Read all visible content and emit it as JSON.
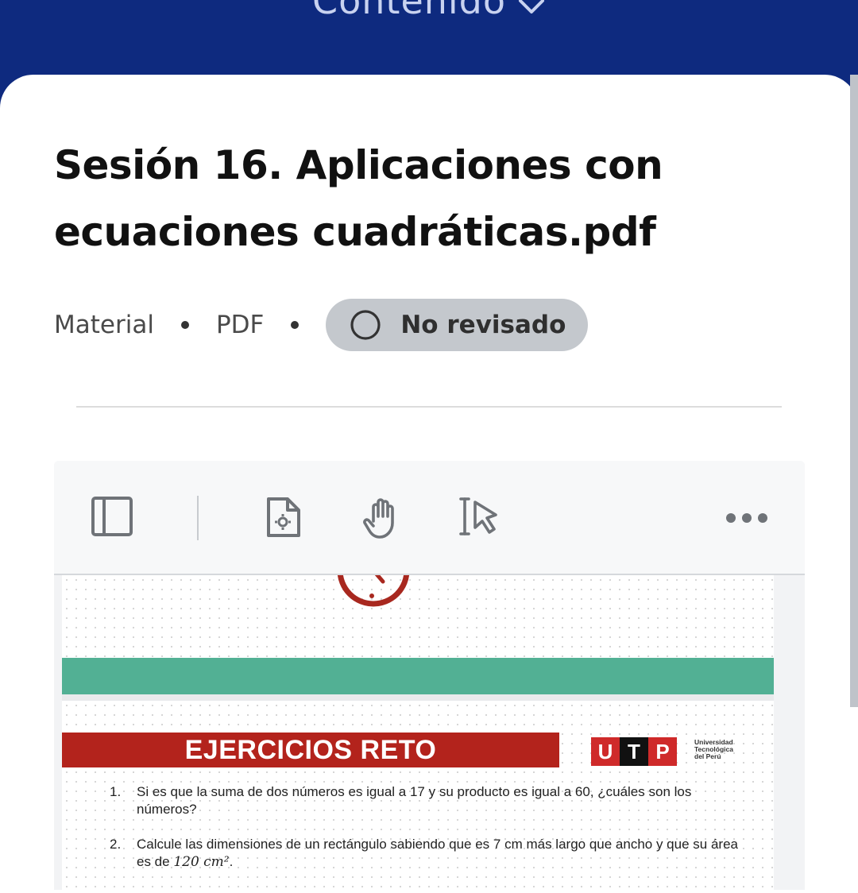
{
  "header": {
    "title": "Contenido"
  },
  "content": {
    "title": "Sesión 16. Aplicaciones con ecuaciones cuadráticas.pdf",
    "meta": {
      "category": "Material",
      "type": "PDF",
      "status_label": "No revisado"
    }
  },
  "toolbar": {
    "icons": [
      "sidebar-icon",
      "document-settings-icon",
      "hand-pan-icon",
      "text-select-icon",
      "more-icon"
    ]
  },
  "pdf": {
    "banner_title": "EJERCICIOS RETO",
    "logo": {
      "letters": [
        "U",
        "T",
        "P"
      ],
      "text": [
        "Universidad",
        "Tecnológica",
        "del Perú"
      ]
    },
    "questions": [
      {
        "num": "1.",
        "text": "Si es que la suma de dos números es igual a 17 y su producto es igual a 60, ¿cuáles son los números?"
      },
      {
        "num": "2.",
        "text_before": "Calcule las dimensiones de un rectángulo sabiendo que es 7 cm más largo que ancho y que su área es de ",
        "math": "120 cm²",
        "text_after": "."
      }
    ]
  },
  "colors": {
    "header_bg": "#0e2a7f",
    "banner_red": "#b3231c",
    "band_green": "#52b094",
    "badge_gray": "#c4c8cd"
  }
}
